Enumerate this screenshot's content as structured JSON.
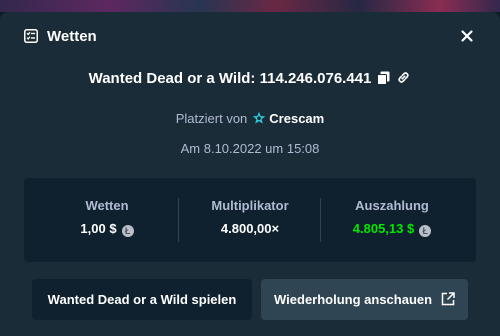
{
  "modal": {
    "title": "Wetten",
    "icons": {
      "header": "bet-list-icon",
      "close": "close-icon",
      "copy": "copy-icon",
      "link": "link-icon",
      "star": "vip-star-icon",
      "coin": "litecoin-icon",
      "external": "external-link-icon"
    }
  },
  "bet": {
    "title": "Wanted Dead or a Wild: 114.246.076.441",
    "placed_prefix": "Platziert von",
    "user": "Crescam",
    "date": "Am 8.10.2022 um 15:08"
  },
  "stats": {
    "wager_label": "Wetten",
    "wager_value": "1,00 $",
    "multiplier_label": "Multiplikator",
    "multiplier_value": "4.800,00×",
    "payout_label": "Auszahlung",
    "payout_value": "4.805,13 $",
    "coin_symbol": "Ł"
  },
  "actions": {
    "play_label": "Wanted Dead or a Wild spielen",
    "replay_label": "Wiederholung anschauen"
  },
  "colors": {
    "background": "#1a2c38",
    "panel": "#0f212e",
    "secondary_button": "#2f4553",
    "muted_text": "#b1bad3",
    "payout_green": "#00e701",
    "vip_star": "#2ec4d6"
  }
}
